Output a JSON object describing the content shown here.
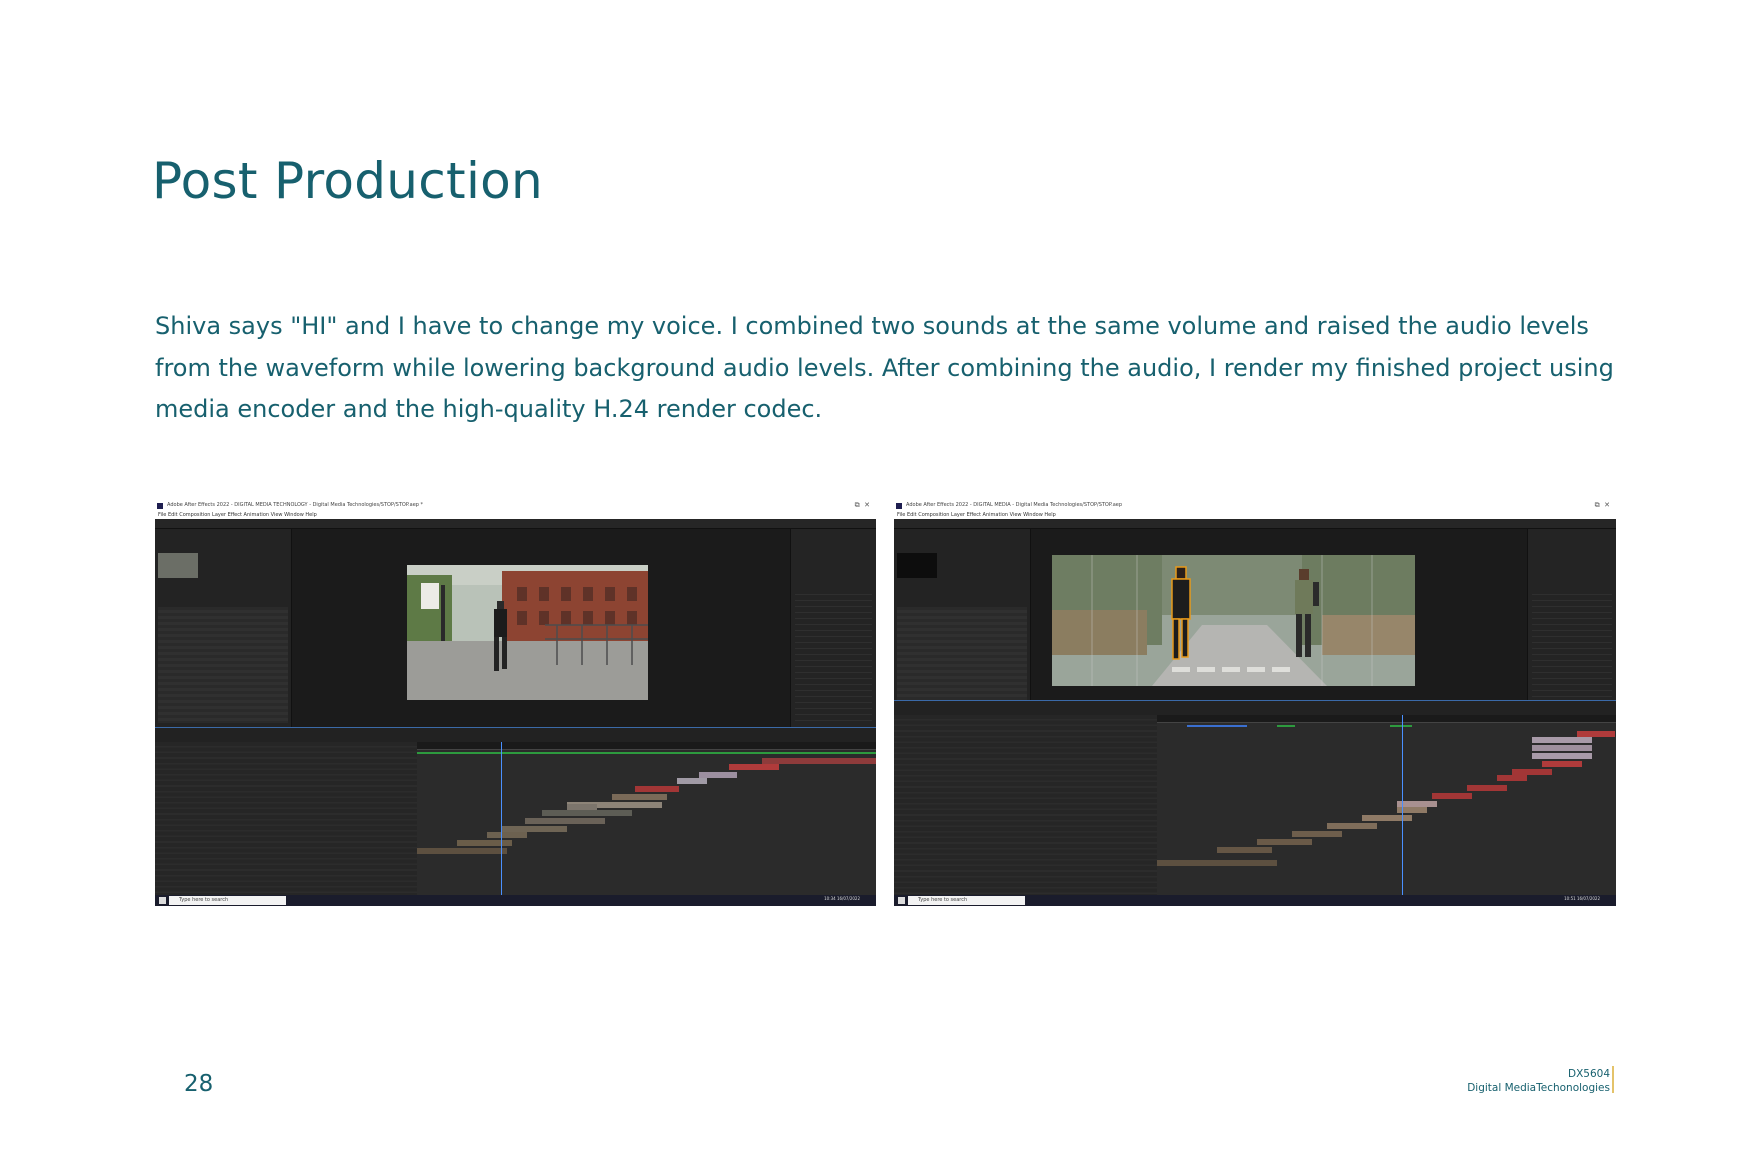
{
  "page": {
    "title": "Post Production",
    "body": "Shiva says \"HI\" and I have to change my voice. I combined two sounds at the same volume and raised the audio levels from the waveform while lowering background audio levels. After combining the audio, I render my finished project using media encoder and the high-quality H.24 render codec.",
    "page_number": "28",
    "footer_code": "DX5604",
    "footer_title": "Digital MediaTechonologies"
  },
  "screenshots": [
    {
      "window_title": "Adobe After Effects 2022 - DIGITAL MEDIA TECHNOLOGY - Digital Media Technologies/STOP/STOP.aep *",
      "menu": "File   Edit   Composition   Layer   Effect   Animation   View   Window   Help",
      "search_placeholder": "Type here to search",
      "clock": "10:34 16/07/2022"
    },
    {
      "window_title": "Adobe After Effects 2022 - DIGITAL MEDIA - Digital Media Technologies/STOP/STOP.aep",
      "menu": "File   Edit   Composition   Layer   Effect   Animation   View   Window   Help",
      "search_placeholder": "Type here to search",
      "clock": "10:51 16/07/2022"
    }
  ],
  "colors": {
    "accent": "#17606e",
    "footer_rule": "#e4c36a"
  }
}
